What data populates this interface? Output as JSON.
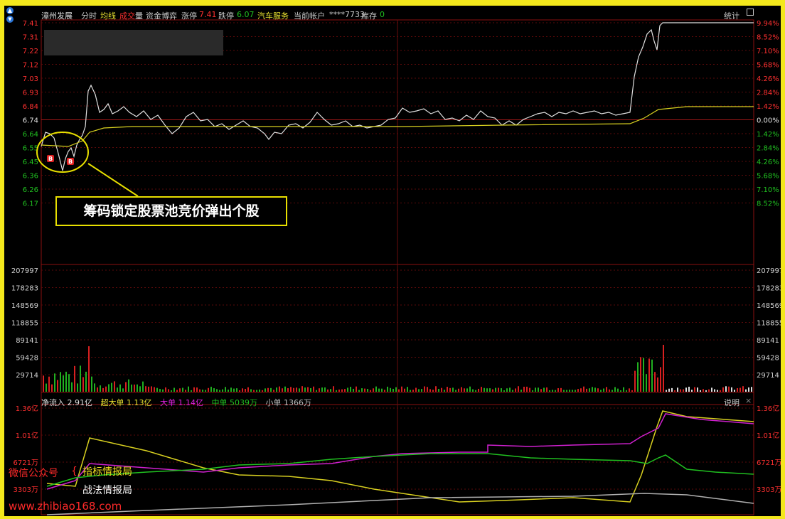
{
  "header": {
    "stock_name": "漳州发展",
    "tab_intraday": "分时",
    "avg_line": "均线",
    "vol_label_1": "成交",
    "vol_label_2": "量",
    "fund_game": "资金博弈",
    "limit_up_label": "涨停",
    "limit_up_value": "7.41",
    "limit_down_label": "跌停",
    "limit_down_value": "6.07",
    "sector": "汽车服务",
    "account_label": "当前帐户",
    "account_value": "****7733",
    "stock_label": "库存",
    "stock_value": "0",
    "stats_button": "统计",
    "up_icon": "caret-up-icon",
    "down_icon": "caret-down-icon"
  },
  "price_axis": {
    "left": [
      "7.41",
      "7.31",
      "7.22",
      "7.12",
      "7.03",
      "6.93",
      "6.84",
      "6.74",
      "6.64",
      "6.55",
      "6.45",
      "6.36",
      "6.26",
      "6.17"
    ],
    "right": [
      "9.94%",
      "8.52%",
      "7.10%",
      "5.68%",
      "4.26%",
      "2.84%",
      "1.42%",
      "0.00%",
      "1.42%",
      "2.84%",
      "4.26%",
      "5.68%",
      "7.10%",
      "8.52%"
    ]
  },
  "volume_axis": [
    "207997",
    "178283",
    "148569",
    "118855",
    "89141",
    "59428",
    "29714"
  ],
  "flow_axis": [
    "1.36亿",
    "1.01亿",
    "6721万",
    "3303万"
  ],
  "flow_bar": {
    "net_inflow": "净流入 2.91亿",
    "super_large": "超大单 1.13亿",
    "large": "大单 1.14亿",
    "medium": "中单 5039万",
    "small": "小单 1366万",
    "help": "说明"
  },
  "markers": [
    "B",
    "B"
  ],
  "callout": "筹码锁定股票池竞价弹出个股",
  "watermark": {
    "line1": "微信公众号",
    "line2": "指标情报局",
    "line3": "战法情报局",
    "url": "www.zhibiao168.com"
  },
  "colors": {
    "background": "#000000",
    "frame": "#f4e81c",
    "price_line": "#e0e0e0",
    "avg_line": "#d8d020",
    "up": "#ff3030",
    "down": "#20c020",
    "super_large": "#d8d020",
    "large": "#d020d0",
    "medium": "#20c020",
    "small": "#b0b0b0"
  }
}
